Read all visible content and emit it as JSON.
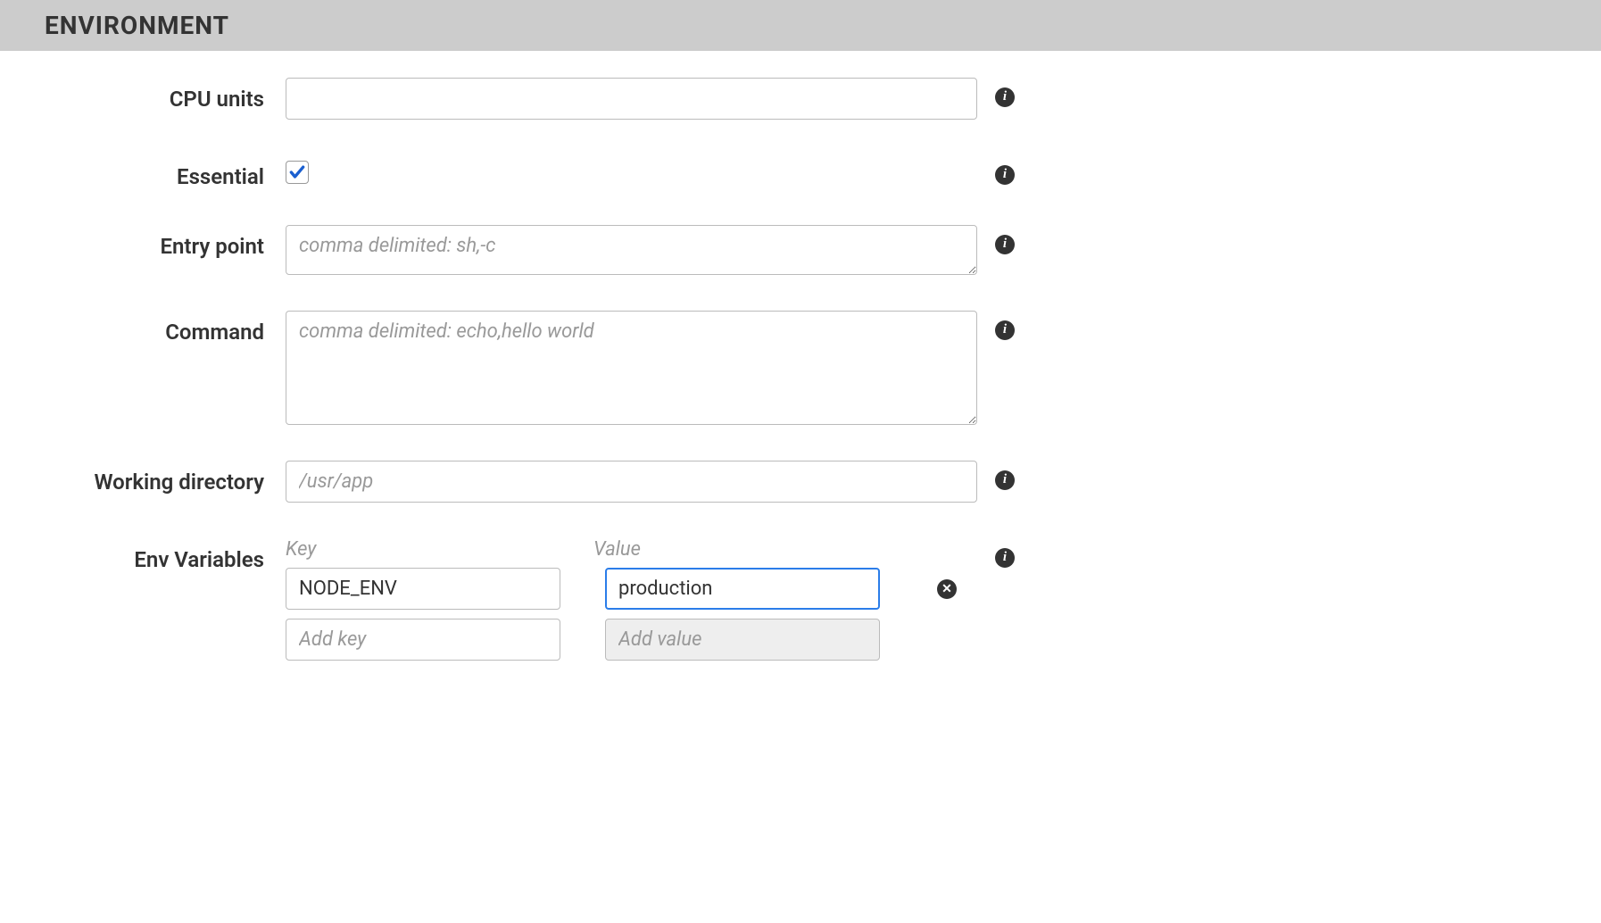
{
  "section": {
    "title": "ENVIRONMENT"
  },
  "fields": {
    "cpu_units": {
      "label": "CPU units",
      "value": ""
    },
    "essential": {
      "label": "Essential",
      "checked": true
    },
    "entry_point": {
      "label": "Entry point",
      "placeholder": "comma delimited: sh,-c",
      "value": ""
    },
    "command": {
      "label": "Command",
      "placeholder": "comma delimited: echo,hello world",
      "value": ""
    },
    "working_directory": {
      "label": "Working directory",
      "placeholder": "/usr/app",
      "value": ""
    },
    "env_variables": {
      "label": "Env Variables",
      "key_header": "Key",
      "value_header": "Value",
      "rows": [
        {
          "key": "NODE_ENV",
          "value": "production"
        }
      ],
      "add_key_placeholder": "Add key",
      "add_value_placeholder": "Add value"
    }
  }
}
